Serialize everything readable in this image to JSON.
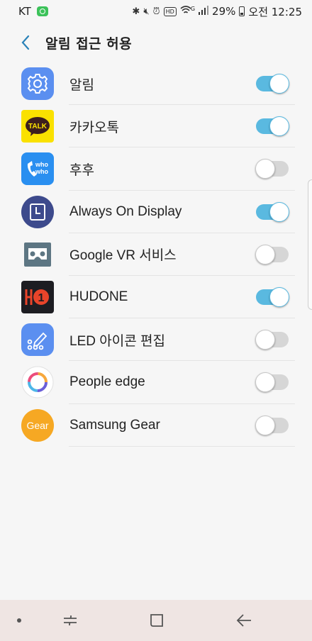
{
  "status_bar": {
    "carrier": "KT",
    "battery": "29%",
    "time": "오전 12:25",
    "hd": "HD",
    "network": "G"
  },
  "header": {
    "title": "알림 접근 허용"
  },
  "apps": [
    {
      "label": "알림",
      "icon": "gear-icon",
      "enabled": true
    },
    {
      "label": "카카오톡",
      "icon": "kakaotalk-icon",
      "icon_text": "TALK",
      "enabled": true
    },
    {
      "label": "후후",
      "icon": "whowho-icon",
      "icon_text": "who who",
      "enabled": false
    },
    {
      "label": "Always On Display",
      "icon": "always-on-display-icon",
      "enabled": true
    },
    {
      "label": "Google VR 서비스",
      "icon": "vr-headset-icon",
      "enabled": false
    },
    {
      "label": "HUDONE",
      "icon": "hudone-icon",
      "icon_text": "1",
      "enabled": true
    },
    {
      "label": "LED 아이콘 편집",
      "icon": "led-edit-icon",
      "enabled": false
    },
    {
      "label": "People edge",
      "icon": "people-edge-icon",
      "enabled": false
    },
    {
      "label": "Samsung Gear",
      "icon": "gear-app-icon",
      "icon_text": "Gear",
      "enabled": false
    }
  ],
  "colors": {
    "toggle_on": "#5ab9e0",
    "toggle_off": "#d6d6d6",
    "accent": "#2b82b8"
  }
}
